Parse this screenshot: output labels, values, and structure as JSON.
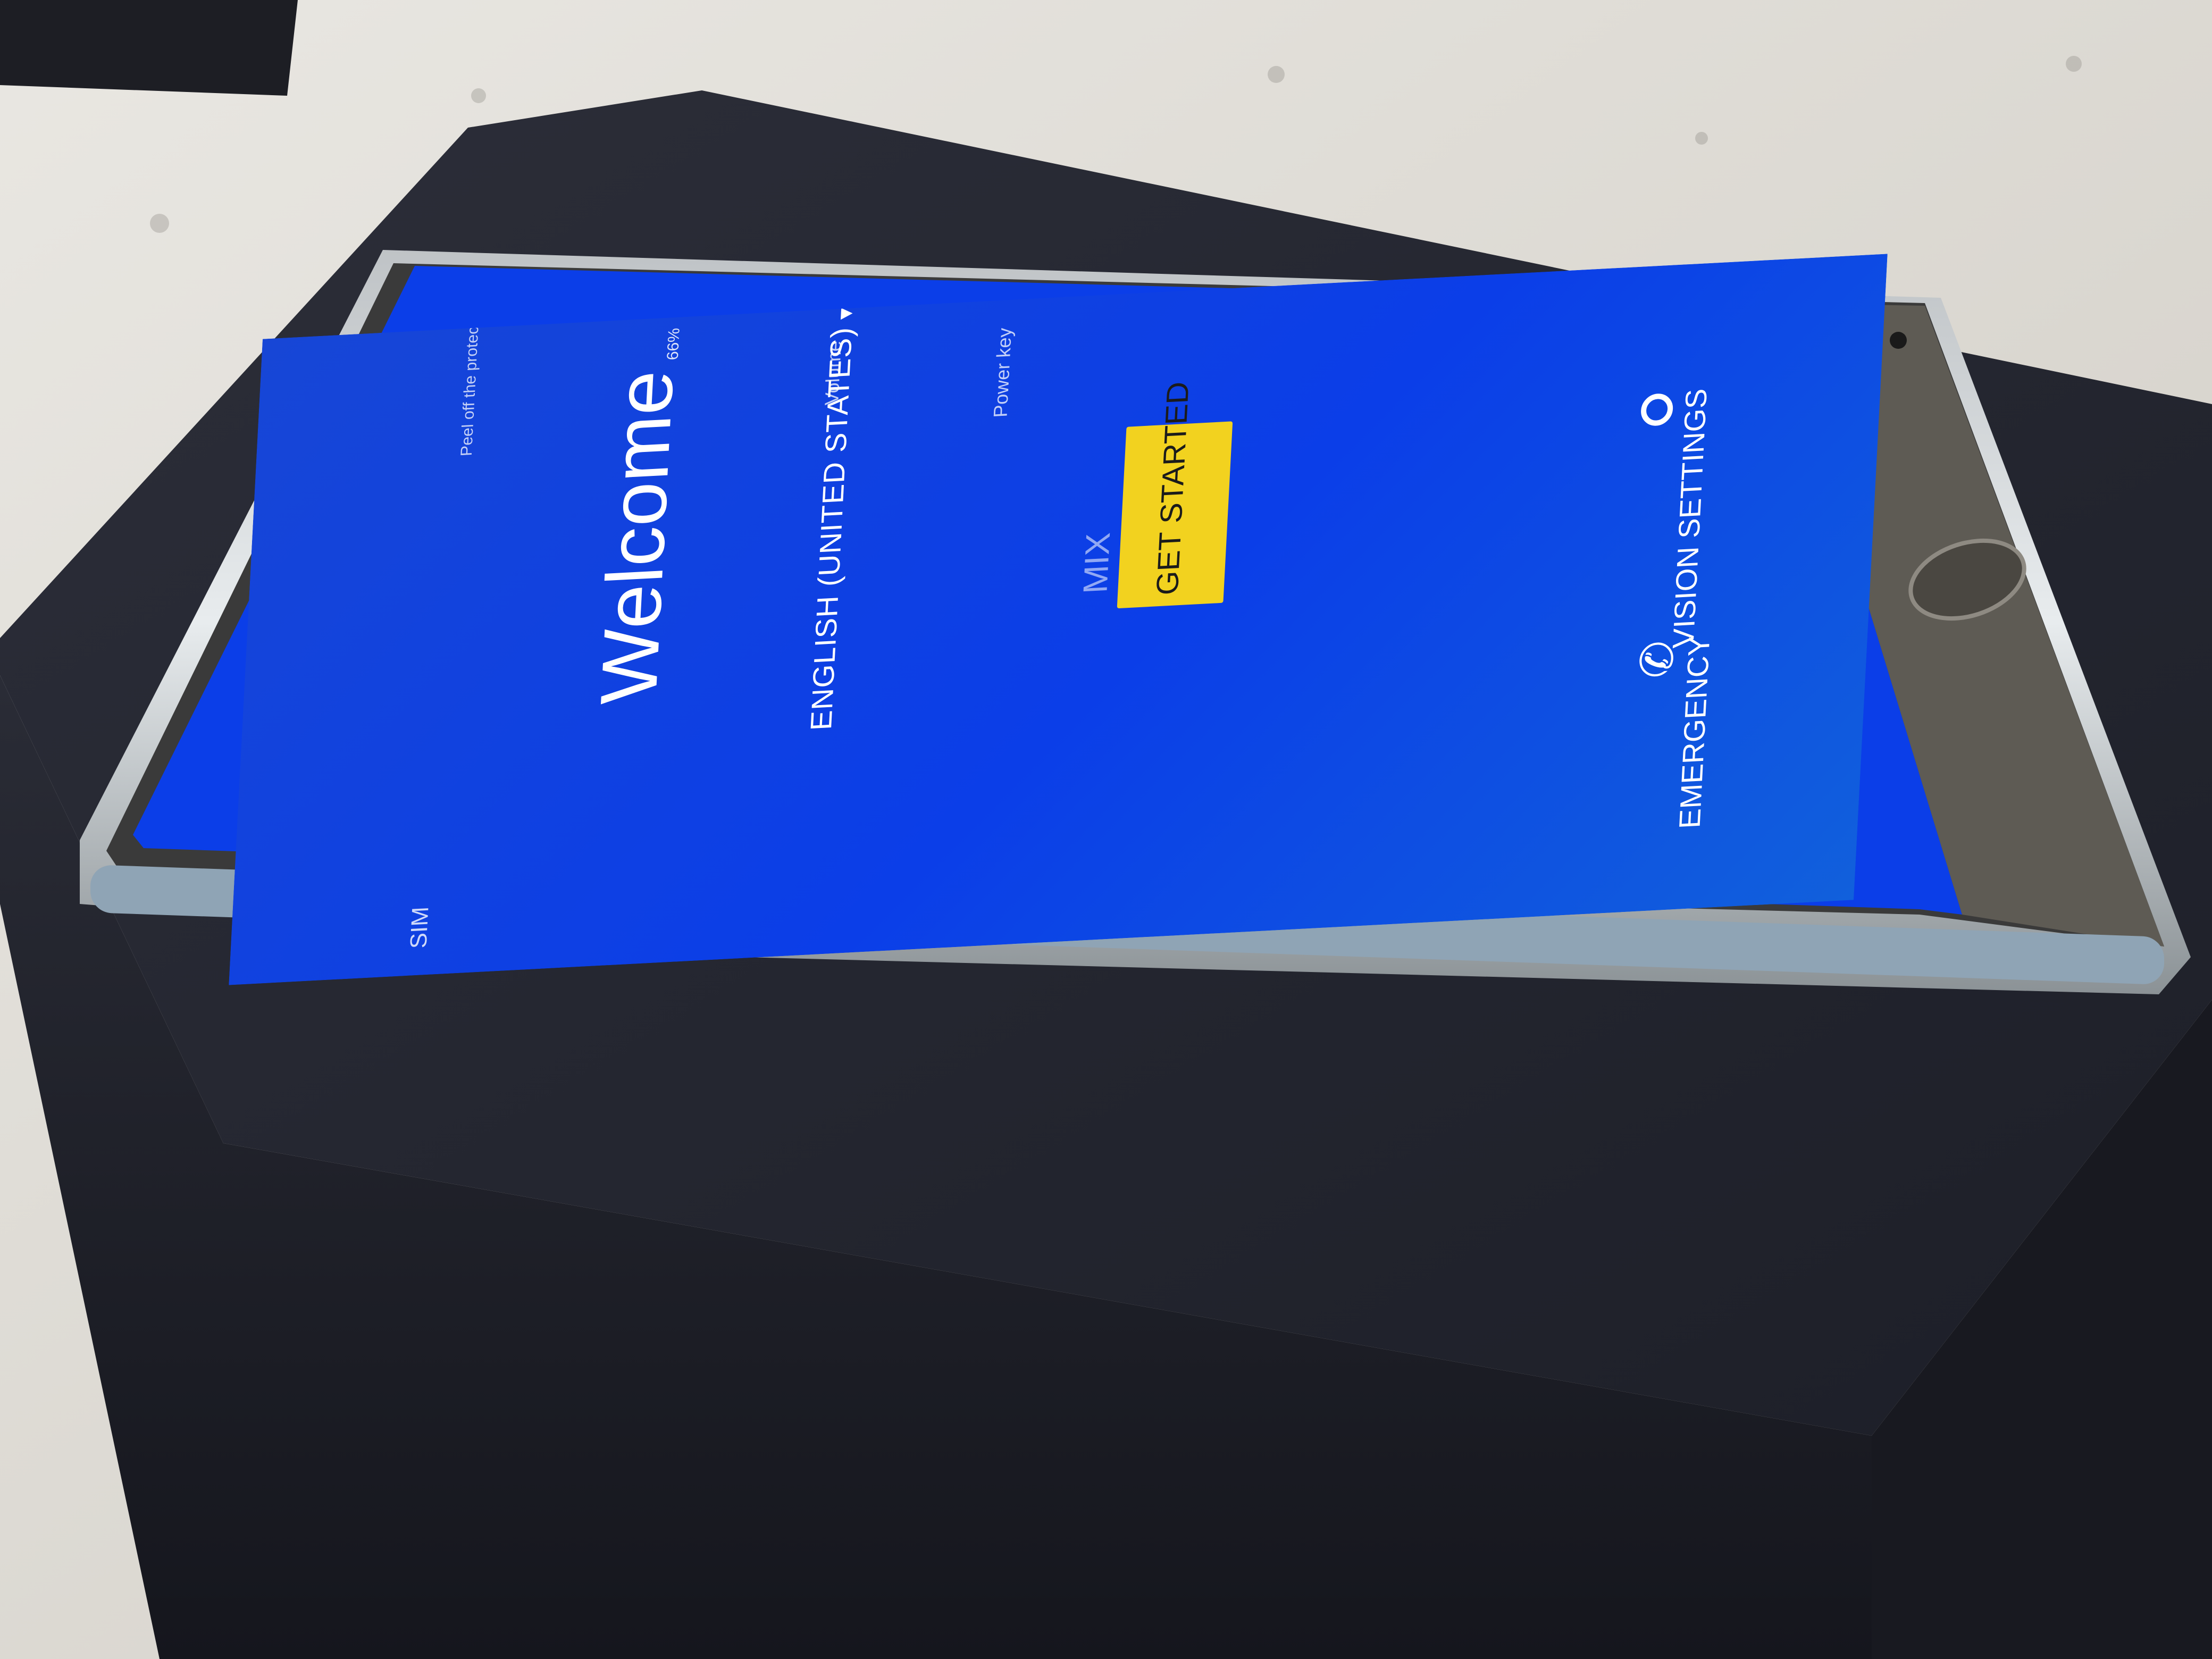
{
  "screen": {
    "welcome": "Welcome",
    "language": "ENGLISH (UNITED STATES)",
    "language_caret": "▾",
    "get_started": "GET STARTED",
    "brand_partial": "MIX",
    "vision_settings": "VISION SETTINGS",
    "emergency": "EMERGENCY",
    "sim": "SIM",
    "volume": "Volume",
    "power_key": "Power key",
    "peel_note": "Peel off the protective film first",
    "battery": "66%"
  },
  "colors": {
    "screen_blue": "#0b3ee8",
    "button_yellow": "#f2d21f"
  },
  "icons": [
    "vision-eye-icon",
    "phone-icon"
  ]
}
